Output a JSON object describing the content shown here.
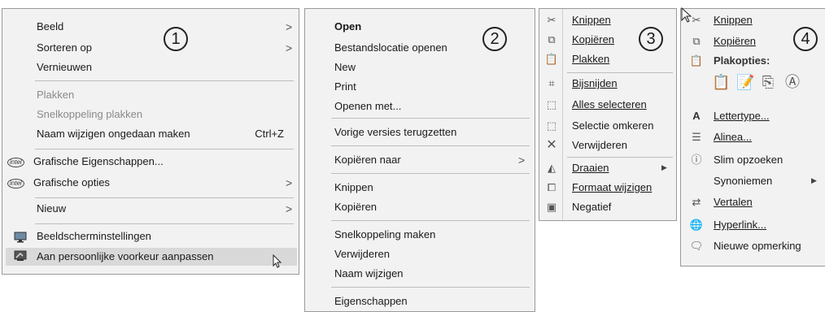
{
  "menu1": {
    "badge": "1",
    "items": [
      {
        "label": "Beeld"
      },
      {
        "label": "Sorteren op"
      },
      {
        "label": "Vernieuwen"
      },
      {
        "label": "Plakken"
      },
      {
        "label": "Snelkoppeling plakken"
      },
      {
        "label": "Naam wijzigen ongedaan maken",
        "shortcut": "Ctrl+Z"
      },
      {
        "label": "Grafische Eigenschappen...",
        "icon": "intel-icon",
        "icon_text": "intel"
      },
      {
        "label": "Grafische opties",
        "icon": "intel-icon",
        "icon_text": "intel"
      },
      {
        "label": "Nieuw"
      },
      {
        "label": "Beeldscherminstellingen",
        "icon": "display-icon"
      },
      {
        "label": "Aan persoonlijke voorkeur aanpassen",
        "icon": "personalize-icon"
      }
    ]
  },
  "menu2": {
    "badge": "2",
    "items": [
      {
        "label": "Open"
      },
      {
        "label": "Bestandslocatie openen"
      },
      {
        "label": "New"
      },
      {
        "label": "Print"
      },
      {
        "label": "Openen met..."
      },
      {
        "label": "Vorige versies terugzetten"
      },
      {
        "label": "Kopiëren naar"
      },
      {
        "label": "Knippen"
      },
      {
        "label": "Kopiëren"
      },
      {
        "label": "Snelkoppeling maken"
      },
      {
        "label": "Verwijderen"
      },
      {
        "label": "Naam wijzigen"
      },
      {
        "label": "Eigenschappen"
      }
    ]
  },
  "menu3": {
    "badge": "3",
    "items": [
      {
        "label": "Knippen",
        "icon": "scissors-icon"
      },
      {
        "label": "Kopiëren",
        "icon": "copy-icon"
      },
      {
        "label": "Plakken",
        "icon": "clipboard-icon"
      },
      {
        "label": "Bijsnijden",
        "icon": "crop-icon"
      },
      {
        "label": "Alles selecteren",
        "icon": "select-all-icon"
      },
      {
        "label": "Selectie omkeren",
        "icon": "invert-selection-icon"
      },
      {
        "label": "Verwijderen",
        "icon": "delete-icon"
      },
      {
        "label": "Draaien",
        "icon": "rotate-icon"
      },
      {
        "label": "Formaat wijzigen",
        "icon": "resize-icon"
      },
      {
        "label": "Negatief",
        "icon": "negative-icon"
      }
    ]
  },
  "menu4": {
    "badge": "4",
    "items": [
      {
        "label": "Knippen",
        "icon": "scissors-icon"
      },
      {
        "label": "Kopiëren",
        "icon": "copy-icon"
      },
      {
        "label": "Plakopties:",
        "icon": "paste-icon"
      },
      {
        "label": "Lettertype...",
        "icon": "font-icon",
        "icon_text": "A"
      },
      {
        "label": "Alinea...",
        "icon": "paragraph-icon"
      },
      {
        "label": "Slim opzoeken",
        "icon": "smart-lookup-icon"
      },
      {
        "label": "Synoniemen"
      },
      {
        "label": "Vertalen",
        "icon": "translate-icon"
      },
      {
        "label": "Hyperlink...",
        "icon": "hyperlink-icon"
      },
      {
        "label": "Nieuwe opmerking",
        "icon": "new-comment-icon"
      }
    ]
  }
}
